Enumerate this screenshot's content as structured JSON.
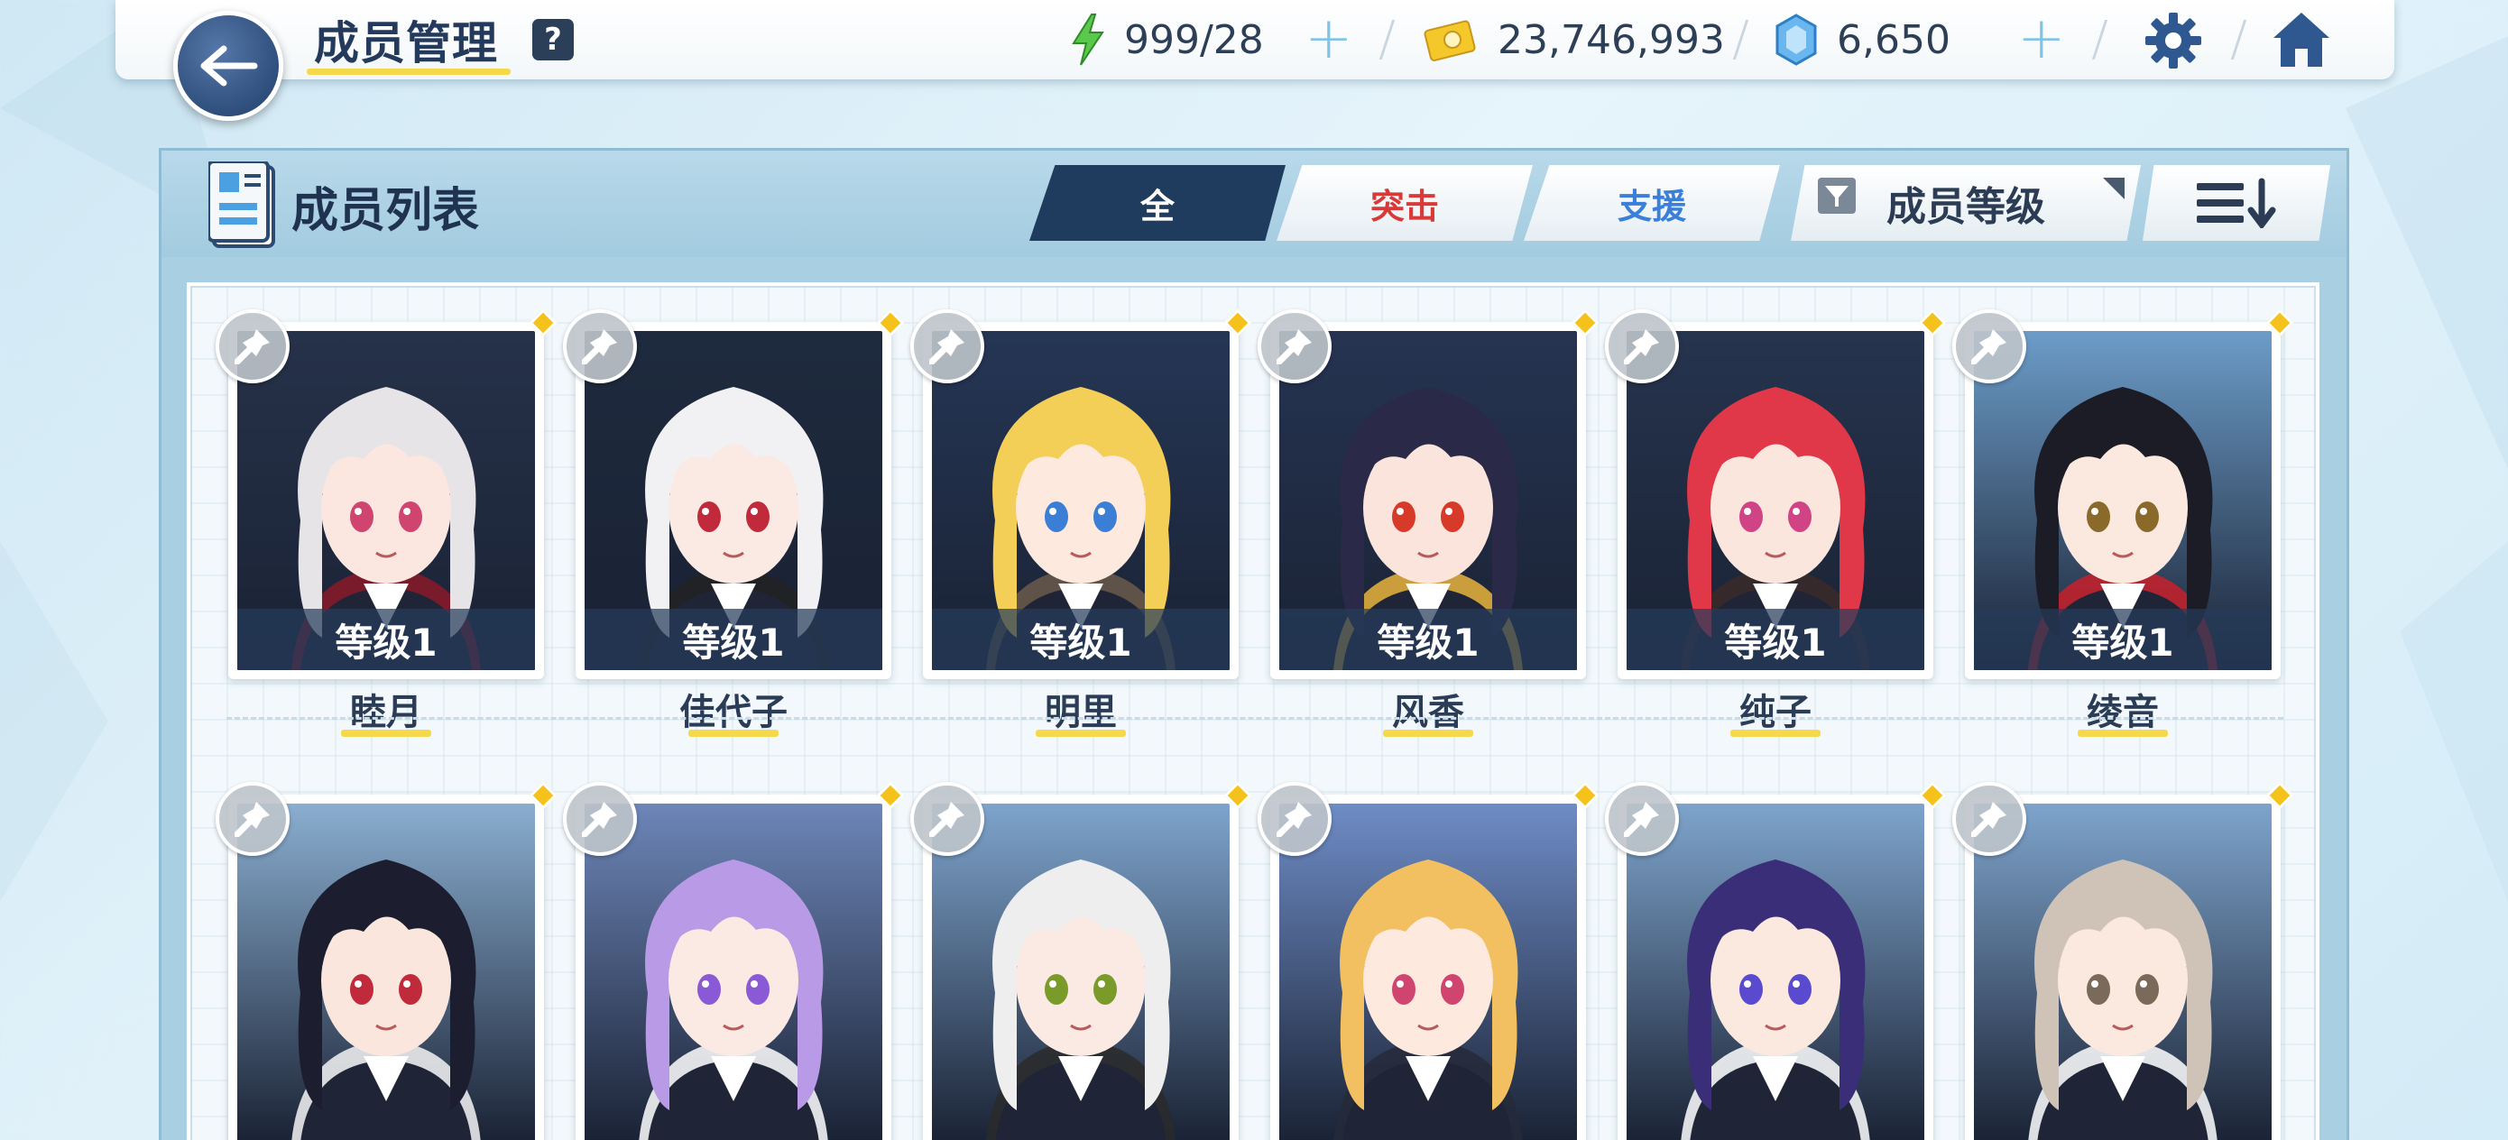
{
  "header": {
    "title": "成员管理",
    "help": "?",
    "ap": "999/28",
    "credits": "23,746,993",
    "pyroxene": "6,650"
  },
  "panel": {
    "title": "成员列表",
    "tabs": [
      {
        "label": "全",
        "active": true
      },
      {
        "label": "突击",
        "active": false
      },
      {
        "label": "支援",
        "active": false
      }
    ],
    "filter": "成员等级"
  },
  "students": [
    {
      "name": "睦月",
      "level": "等级1",
      "bg": "#26324a",
      "hair": "#e6e4e6",
      "accent": "#8b1a2a",
      "eyes": "#d04470",
      "skin": "#fbe7e0"
    },
    {
      "name": "佳代子",
      "level": "等级1",
      "bg": "#1e2a3e",
      "hair": "#f1f1f3",
      "accent": "#222222",
      "eyes": "#c02a3a",
      "skin": "#fbe9e3"
    },
    {
      "name": "明里",
      "level": "等级1",
      "bg": "#253655",
      "hair": "#f4cf58",
      "accent": "#6b5a4a",
      "eyes": "#3b7ed6",
      "skin": "#fde9de"
    },
    {
      "name": "风香",
      "level": "等级1",
      "bg": "#263452",
      "hair": "#2a2a48",
      "accent": "#e9b43c",
      "eyes": "#d83a2a",
      "skin": "#fbe4dc"
    },
    {
      "name": "纯子",
      "level": "等级1",
      "bg": "#26344e",
      "hair": "#e03848",
      "accent": "#3a2a2a",
      "eyes": "#d04486",
      "skin": "#fbe6de"
    },
    {
      "name": "绫音",
      "level": "等级1",
      "bg": "#6c9cc8",
      "hair": "#1c1c26",
      "accent": "#c8202a",
      "eyes": "#8a6a2a",
      "skin": "#fbe8df"
    },
    {
      "name": "",
      "level": "",
      "bg": "#8aaed0",
      "hair": "#1c1e30",
      "accent": "#f4f4f4",
      "eyes": "#c02a3a",
      "skin": "#fbe6de"
    },
    {
      "name": "",
      "level": "",
      "bg": "#6d86b8",
      "hair": "#b89ae6",
      "accent": "#ffffff",
      "eyes": "#8a5ad6",
      "skin": "#fbe9e3"
    },
    {
      "name": "",
      "level": "",
      "bg": "#7ea4cc",
      "hair": "#eeeeee",
      "accent": "#2a2a2a",
      "eyes": "#7a9a2a",
      "skin": "#fbe9e3"
    },
    {
      "name": "",
      "level": "",
      "bg": "#6e8cc6",
      "hair": "#f2c060",
      "accent": "#262a3a",
      "eyes": "#d04470",
      "skin": "#fde9de"
    },
    {
      "name": "",
      "level": "",
      "bg": "#7ea4cc",
      "hair": "#3a2e78",
      "accent": "#ffffff",
      "eyes": "#5a4ad0",
      "skin": "#fbe8df"
    },
    {
      "name": "",
      "level": "",
      "bg": "#7ea4cc",
      "hair": "#cfc3b8",
      "accent": "#ffffff",
      "eyes": "#7a6a5a",
      "skin": "#fbe8df"
    }
  ],
  "colors": {
    "accent_yellow": "#f6d94a",
    "tab_active": "#1f3c5e",
    "striker_red": "#d83a3a",
    "special_blue": "#3c7fd8"
  }
}
